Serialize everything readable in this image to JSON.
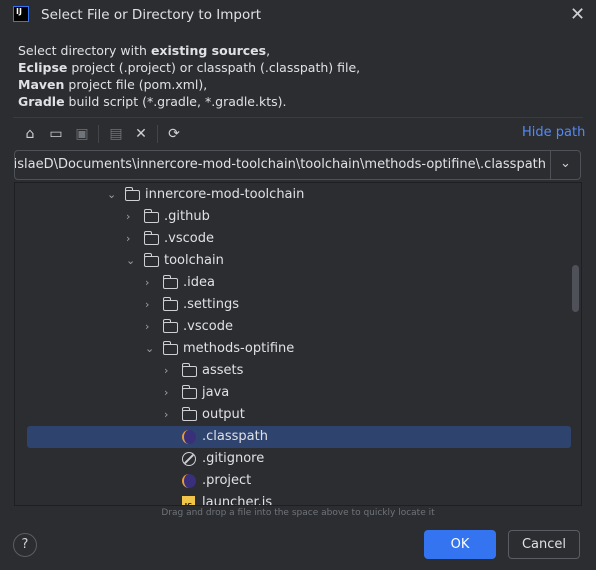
{
  "dialog": {
    "title": "Select File or Directory to Import",
    "logo": "IJ",
    "close_icon": "close-icon"
  },
  "description": {
    "line1": {
      "pre": "Select directory with ",
      "bold": "existing sources",
      "post": ","
    },
    "line2": {
      "bold": "Eclipse",
      "post": " project (.project) or classpath (.classpath) file,"
    },
    "line3": {
      "bold": "Maven",
      "post": " project file (pom.xml),"
    },
    "line4": {
      "bold": "Gradle",
      "post": " build script (*.gradle, *.gradle.kts)."
    }
  },
  "toolbar": {
    "home": "⌂",
    "desktop": "▭",
    "project": "▣",
    "new_folder": "▤",
    "delete": "✕",
    "refresh": "⟳",
    "hide_path": "Hide path"
  },
  "path": {
    "value": "C:\\Users\\MislaeD\\Documents\\innercore-mod-toolchain\\toolchain\\methods-optifine\\.classpath",
    "dropdown": "⌄"
  },
  "tree": [
    {
      "label": "innercore-mod-toolchain",
      "level": 0,
      "type": "folder",
      "expanded": true
    },
    {
      "label": ".github",
      "level": 1,
      "type": "folder",
      "expanded": false
    },
    {
      "label": ".vscode",
      "level": 1,
      "type": "folder",
      "expanded": false
    },
    {
      "label": "toolchain",
      "level": 1,
      "type": "folder",
      "expanded": true
    },
    {
      "label": ".idea",
      "level": 2,
      "type": "folder",
      "expanded": false
    },
    {
      "label": ".settings",
      "level": 2,
      "type": "folder",
      "expanded": false
    },
    {
      "label": ".vscode",
      "level": 2,
      "type": "folder",
      "expanded": false
    },
    {
      "label": "methods-optifine",
      "level": 2,
      "type": "folder",
      "expanded": true
    },
    {
      "label": "assets",
      "level": 3,
      "type": "folder",
      "expanded": false
    },
    {
      "label": "java",
      "level": 3,
      "type": "folder",
      "expanded": false
    },
    {
      "label": "output",
      "level": 3,
      "type": "folder",
      "expanded": false
    },
    {
      "label": ".classpath",
      "level": 3,
      "type": "eclipse",
      "selected": true
    },
    {
      "label": ".gitignore",
      "level": 3,
      "type": "ignore"
    },
    {
      "label": ".project",
      "level": 3,
      "type": "eclipse"
    },
    {
      "label": "launcher.js",
      "level": 3,
      "type": "js"
    }
  ],
  "hint": "Drag and drop a file into the space above to quickly locate it",
  "footer": {
    "help": "?",
    "ok": "OK",
    "cancel": "Cancel"
  },
  "colors": {
    "accent": "#3574f0",
    "selection": "#2e436e",
    "link": "#548af7"
  }
}
